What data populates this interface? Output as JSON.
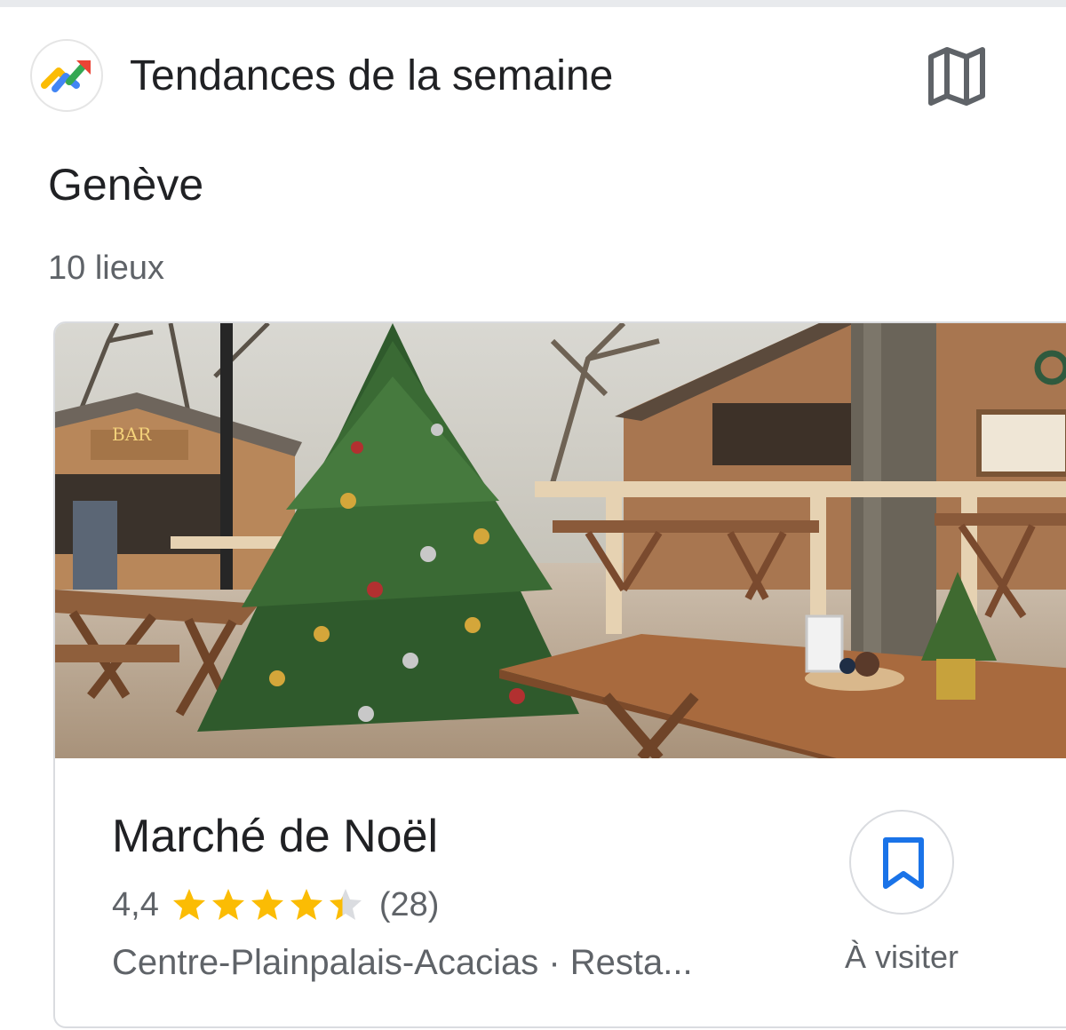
{
  "header": {
    "title": "Tendances de la semaine",
    "app_icon": "trending-arrow-icon",
    "map_icon": "map-icon"
  },
  "list": {
    "city": "Genève",
    "count_label": "10 lieux"
  },
  "place": {
    "name": "Marché de Noël",
    "rating_text": "4,4",
    "rating_value": 4.4,
    "rating_max": 5,
    "reviews_text": "(28)",
    "subtitle": "Centre-Plainpalais-Acacias · Resta...",
    "photo_sign": "BAR",
    "save_label": "À visiter",
    "save_icon": "bookmark-icon"
  },
  "colors": {
    "star": "#fbbc04",
    "star_empty": "#dadce0",
    "accent_blue": "#1a73e8",
    "text_secondary": "#5f6368"
  }
}
